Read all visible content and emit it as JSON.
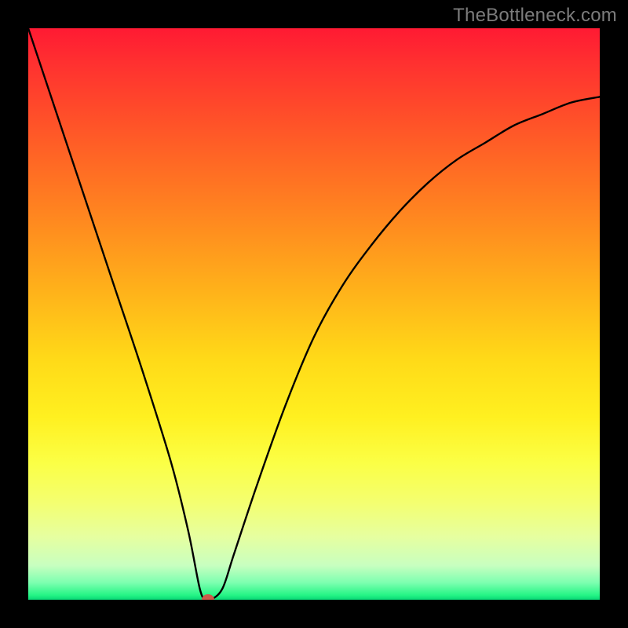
{
  "watermark": "TheBottleneck.com",
  "colors": {
    "frame": "#000000",
    "curve": "#000000",
    "dot": "#cc5a4a"
  },
  "chart_data": {
    "type": "line",
    "title": "",
    "xlabel": "",
    "ylabel": "",
    "xlim": [
      0,
      100
    ],
    "ylim": [
      0,
      100
    ],
    "grid": false,
    "background": "red-to-green vertical gradient",
    "series": [
      {
        "name": "bottleneck-curve",
        "x": [
          0,
          5,
          10,
          15,
          20,
          25,
          28,
          30,
          31,
          32,
          34,
          36,
          40,
          45,
          50,
          55,
          60,
          65,
          70,
          75,
          80,
          85,
          90,
          95,
          100
        ],
        "y": [
          100,
          85,
          70,
          55,
          40,
          24,
          12,
          2,
          0,
          0,
          2,
          8,
          20,
          34,
          46,
          55,
          62,
          68,
          73,
          77,
          80,
          83,
          85,
          87,
          88
        ]
      }
    ],
    "marker": {
      "name": "optimal-point",
      "x": 31.5,
      "y": 0
    },
    "note": "Values estimated from pixel positions; axes unlabeled in source image."
  }
}
